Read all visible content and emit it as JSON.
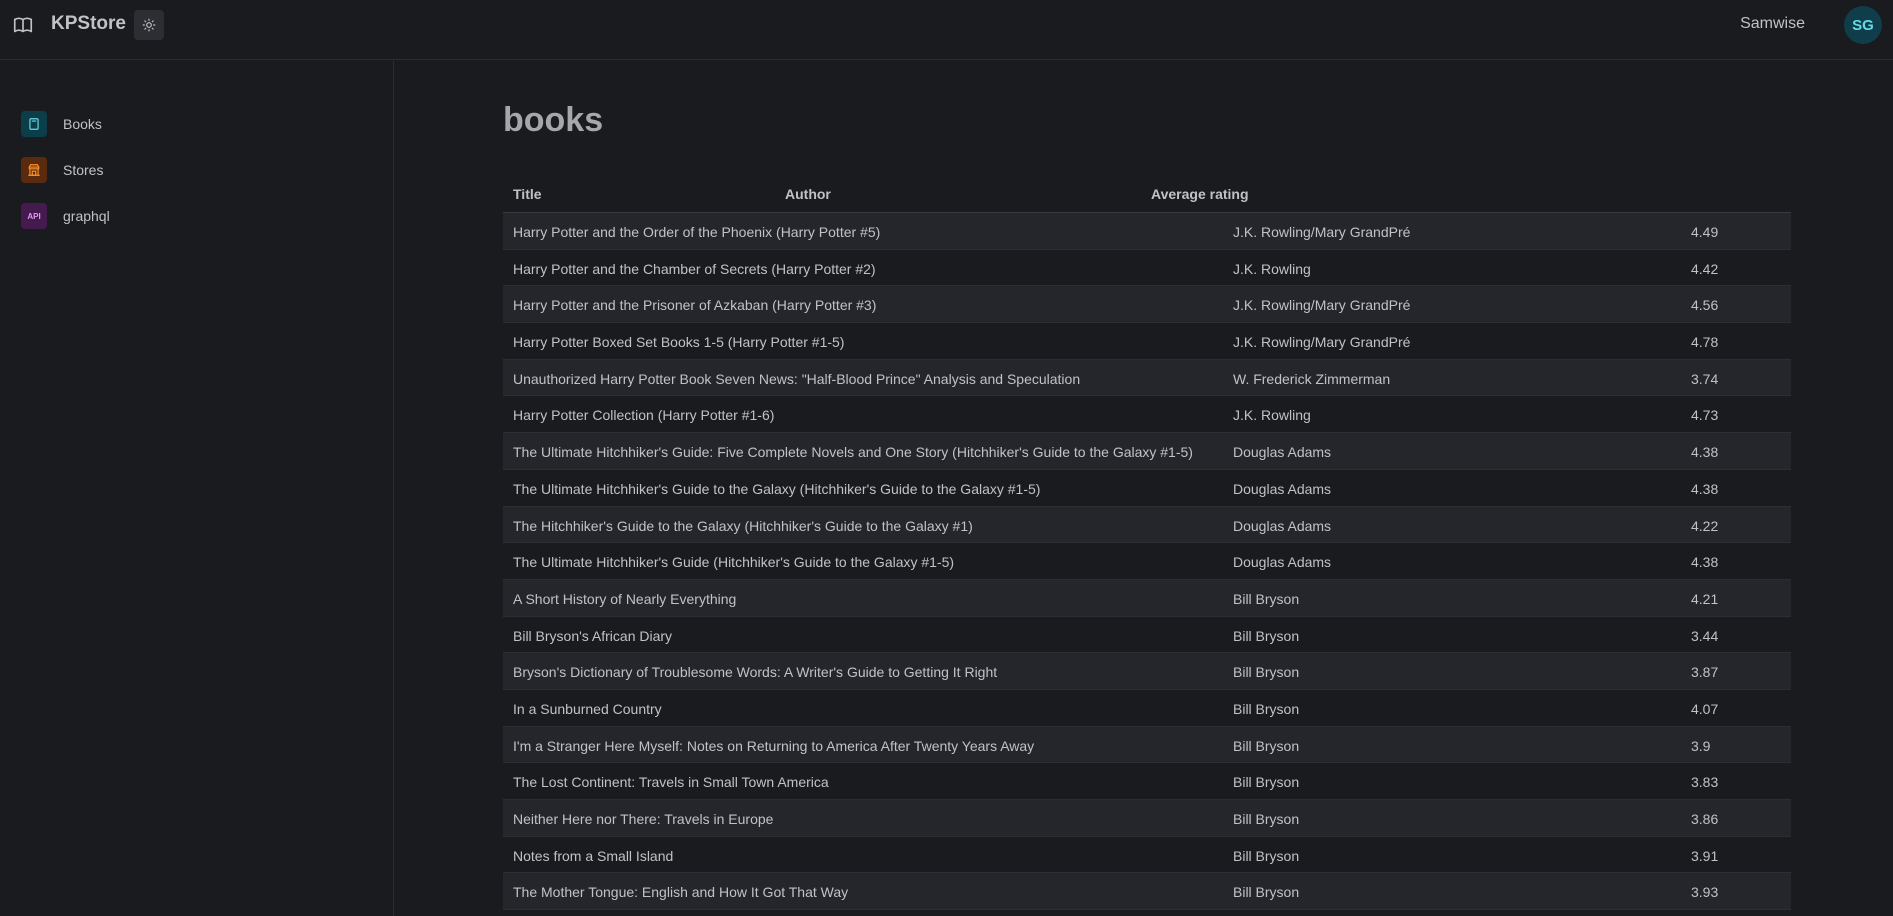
{
  "header": {
    "brand": "KPStore",
    "username": "Samwise",
    "avatar_initials": "SG",
    "icons": [
      "book-open-icon",
      "sun-icon"
    ]
  },
  "sidebar": {
    "items": [
      {
        "label": "Books",
        "icon": "book-icon",
        "color": "#66d9e8"
      },
      {
        "label": "Stores",
        "icon": "building-store-icon",
        "color": "#ff922b"
      },
      {
        "label": "graphql",
        "icon": "api-icon",
        "icon_text": "API",
        "color": "#e599f7"
      }
    ]
  },
  "main": {
    "title": "books",
    "columns": [
      "Title",
      "Author",
      "Average rating"
    ],
    "rows": [
      {
        "title": "Harry Potter and the Order of the Phoenix (Harry Potter #5)",
        "author": "J.K. Rowling/Mary GrandPré",
        "rating": "4.49"
      },
      {
        "title": "Harry Potter and the Chamber of Secrets (Harry Potter #2)",
        "author": "J.K. Rowling",
        "rating": "4.42"
      },
      {
        "title": "Harry Potter and the Prisoner of Azkaban (Harry Potter #3)",
        "author": "J.K. Rowling/Mary GrandPré",
        "rating": "4.56"
      },
      {
        "title": "Harry Potter Boxed Set Books 1-5 (Harry Potter #1-5)",
        "author": "J.K. Rowling/Mary GrandPré",
        "rating": "4.78"
      },
      {
        "title": "Unauthorized Harry Potter Book Seven News: \"Half-Blood Prince\" Analysis and Speculation",
        "author": "W. Frederick Zimmerman",
        "rating": "3.74"
      },
      {
        "title": "Harry Potter Collection (Harry Potter #1-6)",
        "author": "J.K. Rowling",
        "rating": "4.73"
      },
      {
        "title": "The Ultimate Hitchhiker's Guide: Five Complete Novels and One Story (Hitchhiker's Guide to the Galaxy #1-5)",
        "author": "Douglas Adams",
        "rating": "4.38"
      },
      {
        "title": "The Ultimate Hitchhiker's Guide to the Galaxy (Hitchhiker's Guide to the Galaxy #1-5)",
        "author": "Douglas Adams",
        "rating": "4.38"
      },
      {
        "title": "The Hitchhiker's Guide to the Galaxy (Hitchhiker's Guide to the Galaxy #1)",
        "author": "Douglas Adams",
        "rating": "4.22"
      },
      {
        "title": "The Ultimate Hitchhiker's Guide (Hitchhiker's Guide to the Galaxy #1-5)",
        "author": "Douglas Adams",
        "rating": "4.38"
      },
      {
        "title": "A Short History of Nearly Everything",
        "author": "Bill Bryson",
        "rating": "4.21"
      },
      {
        "title": "Bill Bryson's African Diary",
        "author": "Bill Bryson",
        "rating": "3.44"
      },
      {
        "title": "Bryson's Dictionary of Troublesome Words: A Writer's Guide to Getting It Right",
        "author": "Bill Bryson",
        "rating": "3.87"
      },
      {
        "title": "In a Sunburned Country",
        "author": "Bill Bryson",
        "rating": "4.07"
      },
      {
        "title": "I'm a Stranger Here Myself: Notes on Returning to America After Twenty Years Away",
        "author": "Bill Bryson",
        "rating": "3.9"
      },
      {
        "title": "The Lost Continent: Travels in Small Town America",
        "author": "Bill Bryson",
        "rating": "3.83"
      },
      {
        "title": "Neither Here nor There: Travels in Europe",
        "author": "Bill Bryson",
        "rating": "3.86"
      },
      {
        "title": "Notes from a Small Island",
        "author": "Bill Bryson",
        "rating": "3.91"
      },
      {
        "title": "The Mother Tongue: English and How It Got That Way",
        "author": "Bill Bryson",
        "rating": "3.93"
      }
    ]
  }
}
